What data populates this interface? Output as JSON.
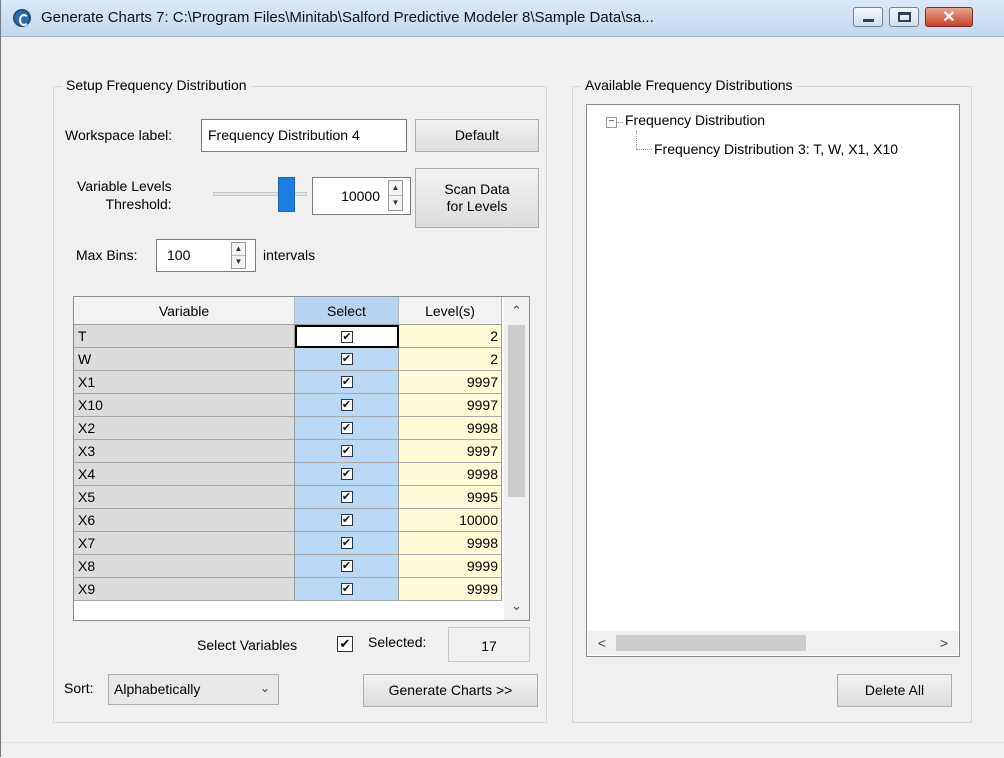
{
  "window": {
    "title": "Generate Charts 7: C:\\Program Files\\Minitab\\Salford Predictive Modeler 8\\Sample Data\\sa...",
    "close_label": "✕"
  },
  "setup": {
    "group_title": "Setup Frequency Distribution",
    "workspace_label": "Workspace label:",
    "workspace_value": "Frequency Distribution 4",
    "default_button": "Default",
    "threshold_label_line1": "Variable Levels",
    "threshold_label_line2": "Threshold:",
    "threshold_value": "10000",
    "threshold_slider_fraction": 0.85,
    "scan_button_line1": "Scan Data",
    "scan_button_line2": "for Levels",
    "maxbins_label": "Max Bins:",
    "maxbins_value": "100",
    "intervals_label": "intervals"
  },
  "grid": {
    "columns": [
      "Variable",
      "Select",
      "Level(s)"
    ],
    "rows": [
      {
        "variable": "T",
        "selected": true,
        "levels": "2"
      },
      {
        "variable": "W",
        "selected": true,
        "levels": "2"
      },
      {
        "variable": "X1",
        "selected": true,
        "levels": "9997"
      },
      {
        "variable": "X10",
        "selected": true,
        "levels": "9997"
      },
      {
        "variable": "X2",
        "selected": true,
        "levels": "9998"
      },
      {
        "variable": "X3",
        "selected": true,
        "levels": "9997"
      },
      {
        "variable": "X4",
        "selected": true,
        "levels": "9998"
      },
      {
        "variable": "X5",
        "selected": true,
        "levels": "9995"
      },
      {
        "variable": "X6",
        "selected": true,
        "levels": "10000"
      },
      {
        "variable": "X7",
        "selected": true,
        "levels": "9998"
      },
      {
        "variable": "X8",
        "selected": true,
        "levels": "9999"
      },
      {
        "variable": "X9",
        "selected": true,
        "levels": "9999"
      }
    ]
  },
  "select_variables": {
    "label": "Select Variables",
    "checked": true,
    "selected_label": "Selected:",
    "selected_count": "17"
  },
  "sort": {
    "label": "Sort:",
    "value": "Alphabetically"
  },
  "generate_button": "Generate Charts >>",
  "available": {
    "group_title": "Available Frequency Distributions",
    "tree_root": "Frequency Distribution",
    "tree_child": "Frequency Distribution 3: T, W, X1, X10"
  },
  "delete_all_button": "Delete All",
  "glyphs": {
    "check": "✔",
    "spin_up": "▲",
    "spin_down": "▼",
    "scroll_up": "⌃",
    "scroll_down": "⌄",
    "scroll_left": "<",
    "scroll_right": ">",
    "combo_arrow": "⌄",
    "tree_minus": "−"
  }
}
